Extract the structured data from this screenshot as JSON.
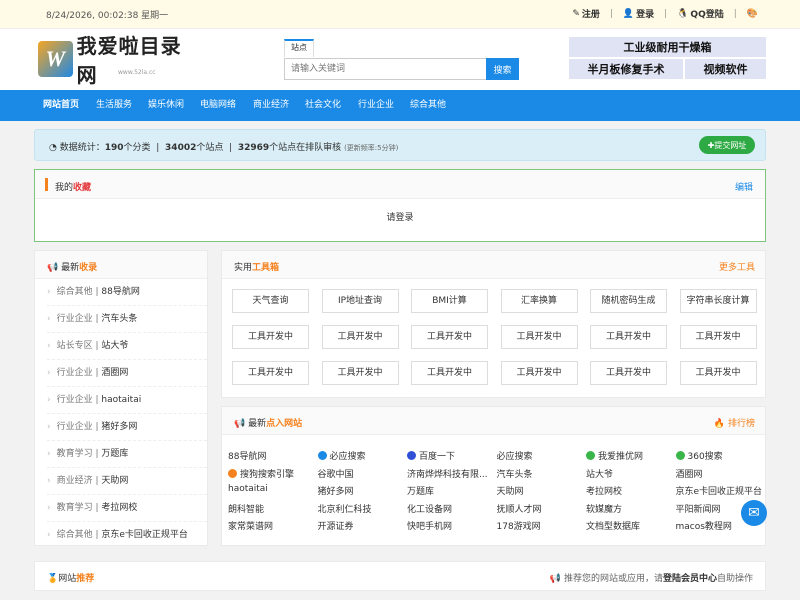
{
  "topbar": {
    "datetime": "8/24/2026, 00:02:38 星期一",
    "register": "注册",
    "login": "登录",
    "qq_login": "QQ登陆"
  },
  "header": {
    "logo_text": "我爱啦目录网",
    "logo_url": "www.52la.cc",
    "search_tab": "站点",
    "search_placeholder": "请输入关键词",
    "search_button": "搜索",
    "ads": [
      "工业级耐用干燥箱",
      "半月板修复手术",
      "视频软件"
    ]
  },
  "nav": [
    "网站首页",
    "生活服务",
    "娱乐休闲",
    "电脑网络",
    "商业经济",
    "社会文化",
    "行业企业",
    "综合其他"
  ],
  "stats": {
    "prefix": "数据统计：",
    "categories": "190",
    "cat_label": "个分类",
    "sites": "34002",
    "sites_label": "个站点",
    "pending": "32969",
    "pending_label": "个站点在排队审核",
    "freq": "(更新频率:5分钟)",
    "submit": "提交网址"
  },
  "favorites": {
    "title_a": "我的",
    "title_b": "收藏",
    "edit": "编辑",
    "body": "请登录"
  },
  "latest": {
    "title_a": "最新",
    "title_b": "收录",
    "items": [
      {
        "cat": "综合其他",
        "name": "88导航网"
      },
      {
        "cat": "行业企业",
        "name": "汽车头条"
      },
      {
        "cat": "站长专区",
        "name": "站大爷"
      },
      {
        "cat": "行业企业",
        "name": "酒圈网"
      },
      {
        "cat": "行业企业",
        "name": "haotaitai"
      },
      {
        "cat": "行业企业",
        "name": "猪好多网"
      },
      {
        "cat": "教育学习",
        "name": "万题库"
      },
      {
        "cat": "商业经济",
        "name": "天助网"
      },
      {
        "cat": "教育学习",
        "name": "考拉网校"
      },
      {
        "cat": "综合其他",
        "name": "京东e卡回收正规平台"
      }
    ]
  },
  "tools": {
    "title_a": "实用",
    "title_b": "工具箱",
    "more": "更多工具",
    "items": [
      "天气查询",
      "IP地址查询",
      "BMI计算",
      "汇率换算",
      "随机密码生成",
      "字符串长度计算",
      "工具开发中",
      "工具开发中",
      "工具开发中",
      "工具开发中",
      "工具开发中",
      "工具开发中",
      "工具开发中",
      "工具开发中",
      "工具开发中",
      "工具开发中",
      "工具开发中",
      "工具开发中"
    ]
  },
  "hits": {
    "title_a": "最新",
    "title_b": "点入网站",
    "rank": "排行榜",
    "items": [
      "88导航网",
      "必应搜索",
      "百度一下",
      "必应搜索",
      "我爱推优网",
      "360搜索",
      "搜狗搜索引擎",
      "谷歌中国",
      "济南烨烨科技有限...",
      "汽车头条",
      "站大爷",
      "酒圈网",
      "haotaitai",
      "猪好多网",
      "万题库",
      "天助网",
      "考拉网校",
      "京东e卡回收正规平台",
      "朗科智能",
      "北京利仁科技",
      "化工设备网",
      "抚顺人才网",
      "软媒魔方",
      "平阳新闻网",
      "家常菜谱网",
      "开源证券",
      "快吧手机网",
      "178游戏网",
      "文档型数据库",
      "macos教程网"
    ]
  },
  "recommend": {
    "title_a": "网站",
    "title_b": "推荐",
    "right_a": "推荐您的网站或应用，请",
    "right_b": "登陆会员中心",
    "right_c": "自助操作"
  },
  "colors": {
    "brand": "#1a8ae6",
    "accent": "#f5821f",
    "submit": "#2eaa44"
  }
}
